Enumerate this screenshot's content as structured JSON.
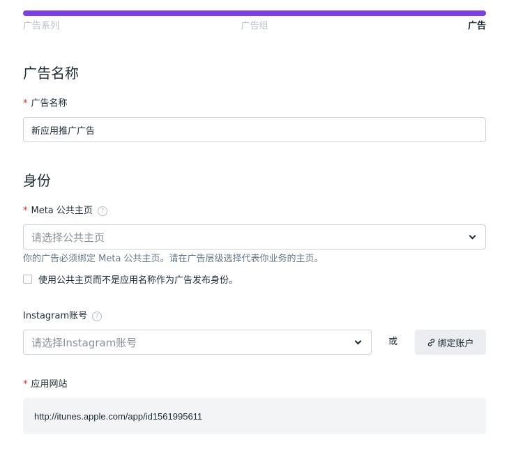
{
  "steps": [
    "广告系列",
    "广告组",
    "广告"
  ],
  "ad_name_section": {
    "title": "广告名称",
    "label": "广告名称",
    "value": "新应用推广广告"
  },
  "identity_section": {
    "title": "身份",
    "page_label": "Meta 公共主页",
    "page_placeholder": "请选择公共主页",
    "page_hint": "你的广告必须绑定 Meta 公共主页。请在广告层级选择代表你业务的主页。",
    "checkbox_label": "使用公共主页而不是应用名称作为广告发布身份。",
    "instagram_label": "Instagram账号",
    "instagram_placeholder": "请选择Instagram账号",
    "or_text": "或",
    "bind_button": "绑定账户",
    "website_label": "应用网站",
    "website_value": "http://itunes.apple.com/app/id1561995611"
  },
  "icons": {
    "help": "question-circle-icon",
    "dropdown": "chevron-down-icon",
    "link": "link-icon"
  },
  "colors": {
    "accent": "#7b3fe4",
    "required": "#d6311f",
    "muted": "#b8bec6"
  }
}
